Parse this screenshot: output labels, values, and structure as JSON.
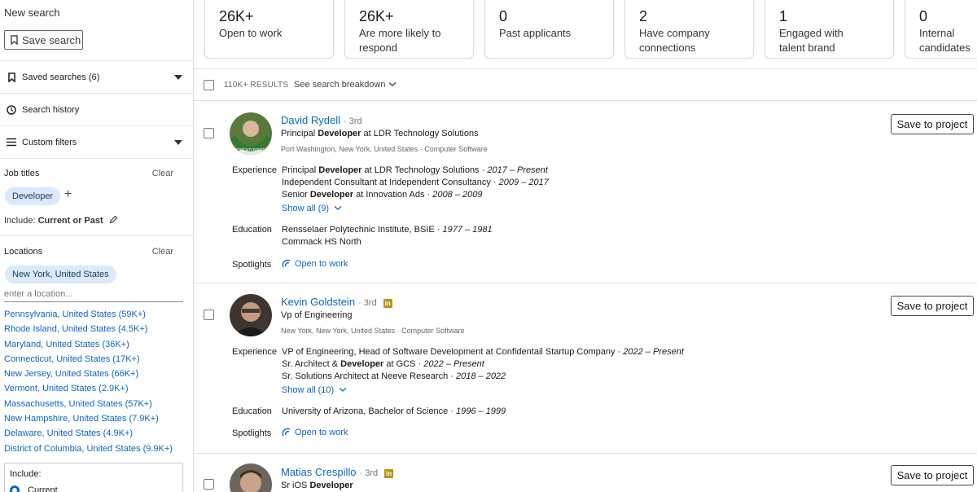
{
  "sidebar": {
    "title": "New search",
    "save_search_label": "Save search",
    "saved_searches_label": "Saved searches (6)",
    "search_history_label": "Search history",
    "custom_filters_label": "Custom filters",
    "job_titles": {
      "heading": "Job titles",
      "clear_label": "Clear",
      "chip": "Developer",
      "include_prefix": "Include:",
      "include_value": "Current or Past"
    },
    "locations": {
      "heading": "Locations",
      "clear_label": "Clear",
      "chip": "New York, United States",
      "input_placeholder": "enter a location...",
      "suggestions": [
        "Pennsylvania, United States (59K+)",
        "Rhode Island, United States (4.5K+)",
        "Maryland, United States (36K+)",
        "Connecticut, United States (17K+)",
        "New Jersey, United States (66K+)",
        "Vermont, United States (2.9K+)",
        "Massachusetts, United States (57K+)",
        "New Hampshire, United States (7.9K+)",
        "Delaware, United States (4.9K+)",
        "District of Columbia, United States (9.9K+)"
      ],
      "include_label": "Include:",
      "include_option": "Current"
    }
  },
  "stats": [
    {
      "num": "26K+",
      "label": "Open to work"
    },
    {
      "num": "26K+",
      "label": "Are more likely to respond"
    },
    {
      "num": "0",
      "label": "Past applicants"
    },
    {
      "num": "2",
      "label": "Have company connections"
    },
    {
      "num": "1",
      "label": "Engaged with talent brand"
    },
    {
      "num": "0",
      "label": "Internal candidates"
    }
  ],
  "results": {
    "count": "110K+ RESULTS",
    "breakdown_label": "See search breakdown"
  },
  "labels": {
    "experience": "Experience",
    "education": "Education",
    "spotlights": "Spotlights",
    "save_to_project": "Save to project",
    "open_to_work": "Open to work"
  },
  "candidates": [
    {
      "name": "David Rydell",
      "degree": "· 3rd",
      "headline_pre": "Principal ",
      "headline_bold": "Developer",
      "headline_post": " at LDR Technology Solutions",
      "location": "Port Washington, New York, United States · Computer Software",
      "experience": [
        {
          "pre": "Principal ",
          "bold": "Developer",
          "post": " at LDR Technology Solutions · ",
          "dates": "2017 – Present"
        },
        {
          "pre": "Independent Consultant at Independent Consultancy · ",
          "bold": "",
          "post": "",
          "dates": "2009 – 2017"
        },
        {
          "pre": "Senior ",
          "bold": "Developer",
          "post": " at Innovation Ads · ",
          "dates": "2008 – 2009"
        }
      ],
      "show_all": "Show all (9)",
      "education": [
        {
          "text": "Rensselaer Polytechnic Institute, BSIE · ",
          "dates": "1977 – 1981"
        },
        {
          "text": "Commack HS North",
          "dates": ""
        }
      ],
      "spotlight": "Open to work"
    },
    {
      "name": "Kevin Goldstein",
      "degree": "· 3rd",
      "headline_pre": "Vp of Engineering",
      "headline_bold": "",
      "headline_post": "",
      "location": "New York, New York, United States · Computer Software",
      "experience": [
        {
          "pre": "VP of Engineering, Head of Software Development at Confidentail Startup Company · ",
          "bold": "",
          "post": "",
          "dates": "2022 – Present"
        },
        {
          "pre": "Sr. Architect & ",
          "bold": "Developer",
          "post": " at GCS · ",
          "dates": "2022 – Present"
        },
        {
          "pre": "Sr. Solutions Architect at Neeve Research · ",
          "bold": "",
          "post": "",
          "dates": "2018 – 2022"
        }
      ],
      "show_all": "Show all (10)",
      "education": [
        {
          "text": "University of Arizona, Bachelor of Science · ",
          "dates": "1996 – 1999"
        }
      ],
      "spotlight": "Open to work"
    },
    {
      "name": "Matias Crespillo",
      "degree": "· 3rd",
      "headline_pre": "Sr iOS ",
      "headline_bold": "Developer",
      "headline_post": ""
    }
  ],
  "colors": {
    "link": "#0a66c2",
    "chip_bg": "#dbeafa",
    "badge": "#b8950f"
  }
}
